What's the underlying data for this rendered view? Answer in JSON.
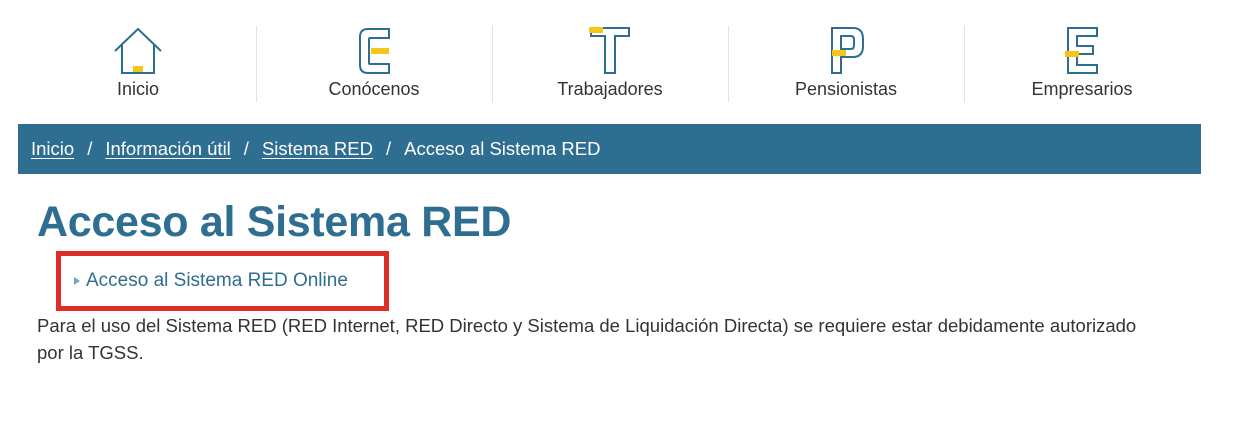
{
  "nav": {
    "items": [
      {
        "label": "Inicio",
        "icon": "home-icon"
      },
      {
        "label": "Conócenos",
        "icon": "letter-c-icon"
      },
      {
        "label": "Trabajadores",
        "icon": "letter-t-icon"
      },
      {
        "label": "Pensionistas",
        "icon": "letter-p-icon"
      },
      {
        "label": "Empresarios",
        "icon": "letter-e-icon"
      }
    ],
    "icon_outline_color": "#2e6e90",
    "icon_accent_color": "#f5c518"
  },
  "breadcrumb": {
    "items": [
      "Inicio",
      "Información útil",
      "Sistema RED"
    ],
    "separator": "/",
    "current": "Acceso al Sistema RED",
    "background": "#2e6e90"
  },
  "page": {
    "title": "Acceso al Sistema RED",
    "link_label": "Acceso al Sistema RED Online",
    "highlight_color": "#dc2e26",
    "description": "Para el uso del Sistema RED (RED Internet, RED Directo y Sistema de Liquidación Directa) se requiere estar debidamente autorizado por la TGSS."
  }
}
